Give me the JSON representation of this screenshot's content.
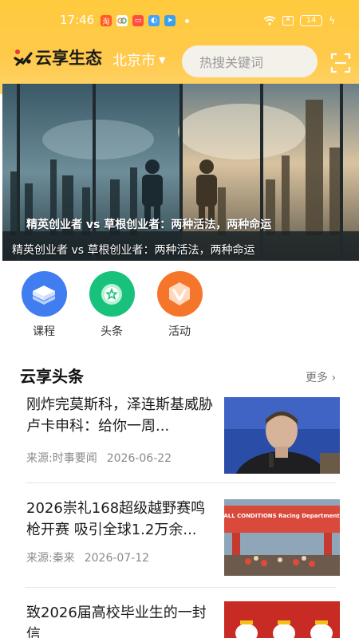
{
  "status_bar": {
    "time": "17:46",
    "battery": "14"
  },
  "header": {
    "brand": "云享生态",
    "city": "北京市",
    "search_placeholder": "热搜关键词"
  },
  "banner": {
    "caption_overlay": "精英创业者 vs 草根创业者：两种活法，两种命运",
    "caption": "精英创业者 vs 草根创业者：两种活法，两种命运"
  },
  "quick_menu": [
    {
      "label": "课程",
      "icon": "course-icon",
      "color": "#3f7df0"
    },
    {
      "label": "头条",
      "icon": "headline-icon",
      "color": "#19c27c"
    },
    {
      "label": "活动",
      "icon": "activity-icon",
      "color": "#f5762b"
    }
  ],
  "section": {
    "title": "云享头条",
    "more": "更多"
  },
  "news": [
    {
      "title": "刚炸完莫斯科，泽连斯基威胁卢卡申科：给你一周...",
      "source": "来源:时事要闻",
      "date": "2026-06-22"
    },
    {
      "title": "2026崇礼168超级越野赛鸣枪开赛 吸引全球1.2万余...",
      "source": "来源:秦来",
      "date": "2026-07-12"
    },
    {
      "title": "致2026届高校毕业生的一封信",
      "source": "",
      "date": ""
    }
  ],
  "thumb_texts": {
    "race_banner": "ALL CONDITIONS Racing Department"
  },
  "colors": {
    "header": "#ffc940",
    "accent_blue": "#3f7df0",
    "accent_green": "#19c27c",
    "accent_orange": "#f5762b"
  }
}
